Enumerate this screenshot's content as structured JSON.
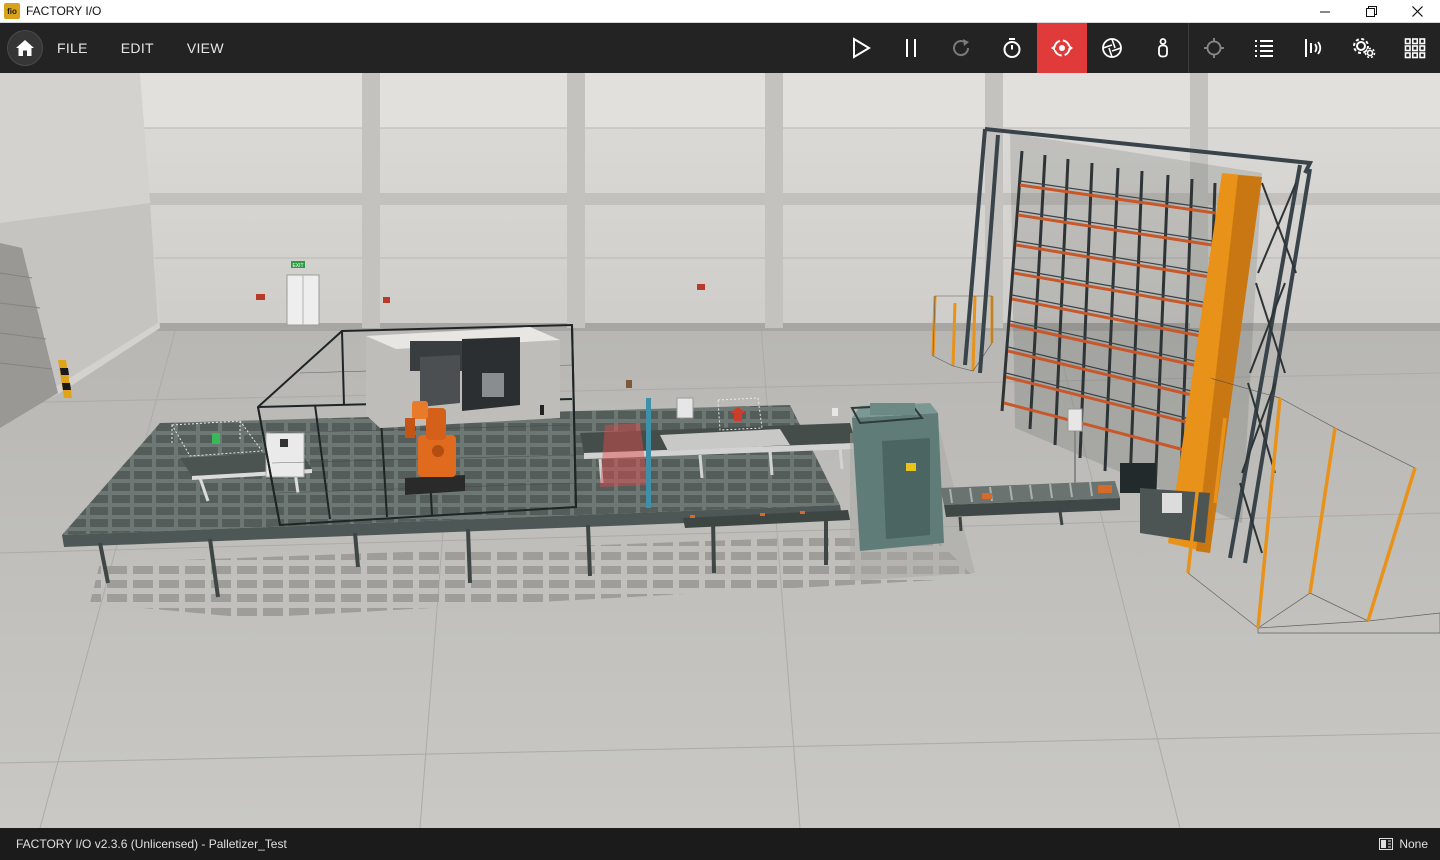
{
  "window": {
    "title": "FACTORY I/O",
    "app_icon_text": "fio"
  },
  "toolbar": {
    "menu": [
      "FILE",
      "EDIT",
      "VIEW"
    ],
    "active_tool": "fly-camera"
  },
  "scene": {
    "exit_sign": "EXIT"
  },
  "statusbar": {
    "text": "FACTORY I/O v2.3.6 (Unlicensed)  - Palletizer_Test",
    "right_label": "None"
  },
  "colors": {
    "toolbar_bg": "#232323",
    "active_tool_bg": "#e03a3a",
    "floor": "#bdbcb8",
    "wall": "#d6d5d2",
    "safety_orange": "#e8921a",
    "machine_teal": "#5f7c78"
  }
}
